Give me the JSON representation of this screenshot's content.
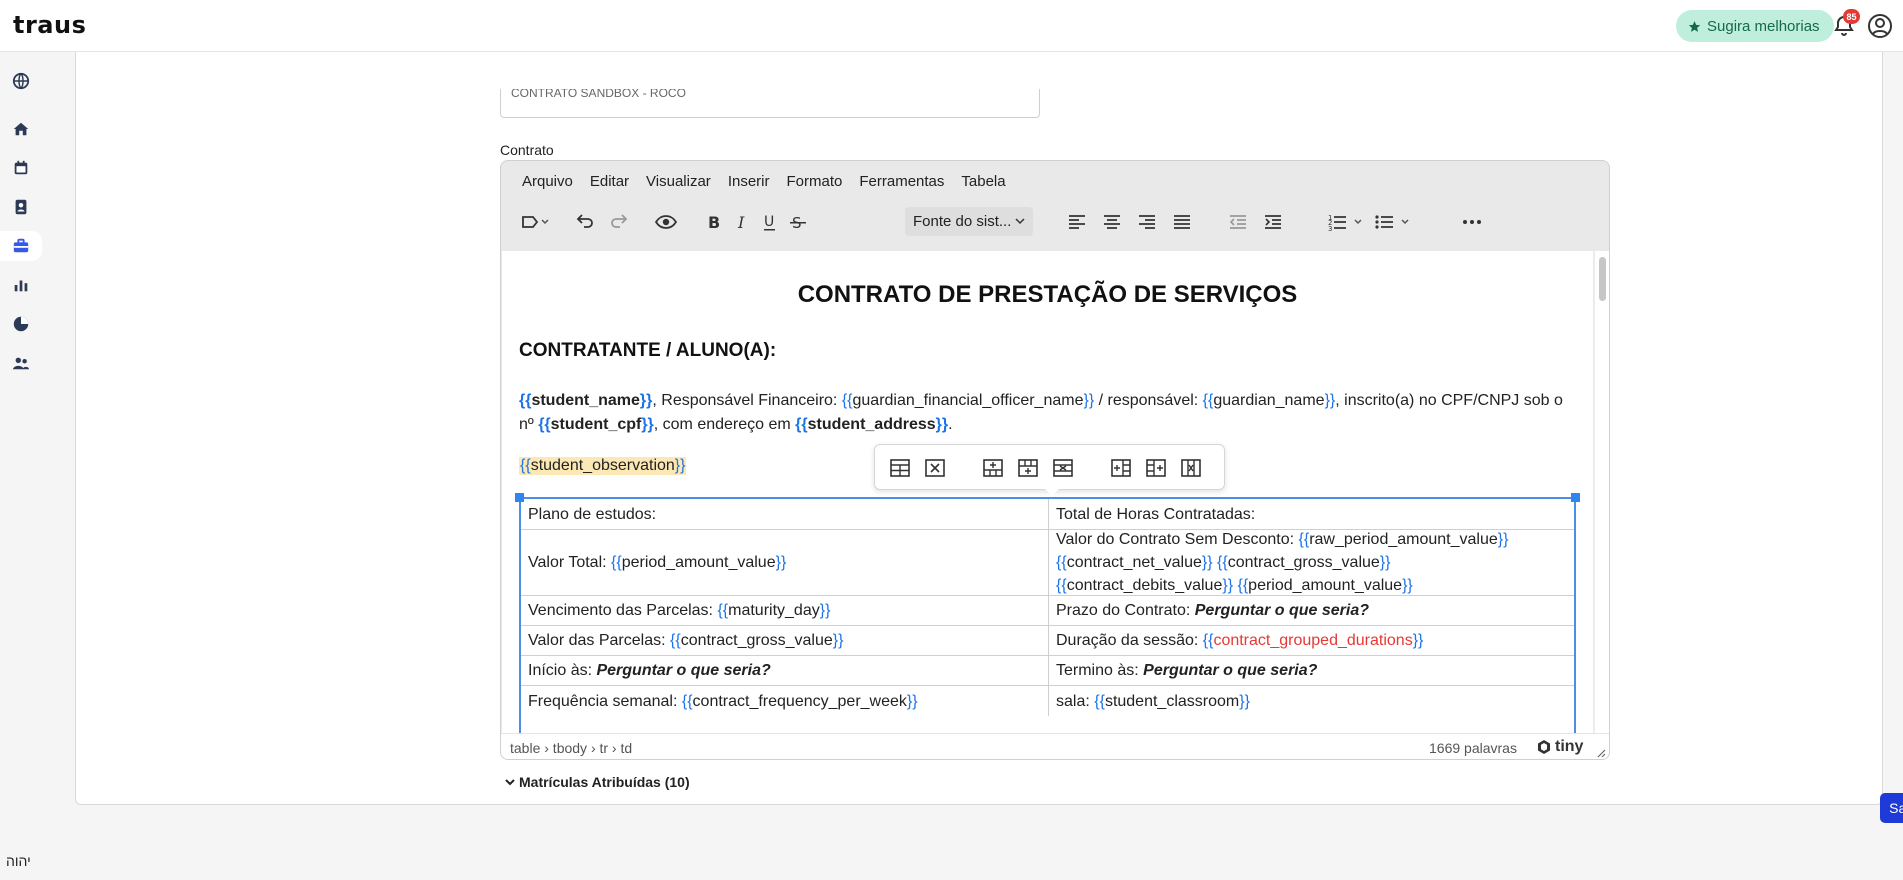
{
  "topbar": {
    "logo": "traus",
    "suggest_label": "Sugira melhorias",
    "notification_count": "85"
  },
  "sidebar": {
    "items": [
      "globe-icon",
      "home-icon",
      "calendar-icon",
      "contacts-icon",
      "briefcase-icon",
      "bar-chart-icon",
      "pie-chart-icon",
      "team-icon"
    ],
    "active_index": 4,
    "footer_text": "יהוה"
  },
  "form": {
    "name_value": "CONTRATO SANDBOX - ROCO",
    "contract_label": "Contrato",
    "enrollments_label": "Matrículas Atribuídas (10)",
    "save_label": "Salvar"
  },
  "editor": {
    "menu": [
      "Arquivo",
      "Editar",
      "Visualizar",
      "Inserir",
      "Formato",
      "Ferramentas",
      "Tabela"
    ],
    "font_select": "Fonte do sist...",
    "status_path": "table › tbody › tr › td",
    "word_count": "1669 palavras",
    "brand": "tiny"
  },
  "document": {
    "title": "CONTRATO DE PRESTAÇÃO DE SERVIÇOS",
    "party_title": "CONTRATANTE / ALUNO(A):",
    "party": {
      "student_name": "student_name",
      "t1": ", Responsável Financeiro: ",
      "guardian_financial": "guardian_financial_officer_name",
      "t2": " / responsável: ",
      "guardian_name": "guardian_name",
      "t3": ", inscrito(a) no CPF/CNPJ sob o nº ",
      "student_cpf": "student_cpf",
      "t4": ", com endereço em ",
      "student_address": "student_address",
      "t5": "."
    },
    "observation": "student_observation",
    "table": {
      "r1c1": "Plano de estudos:",
      "r1c2": "Total de Horas Contratadas:",
      "r2c1_label": "Valor Total: ",
      "r2c1_var": "period_amount_value",
      "r2c2_label": "Valor do Contrato Sem Desconto: ",
      "r2c2_v1": "raw_period_amount_value",
      "r2c2_v2": "contract_net_value",
      "r2c2_v3": "contract_gross_value",
      "r2c2_v4": "contract_debits_value",
      "r2c2_v5": "period_amount_value",
      "r3c1_label": "Vencimento das Parcelas: ",
      "r3c1_var": "maturity_day",
      "r3c2_label": "Prazo do Contrato: ",
      "r3c2_value": "Perguntar o que seria?",
      "r4c1_label": "Valor das Parcelas: ",
      "r4c1_var": "contract_gross_value",
      "r4c2_label": "Duração da sessão: ",
      "r4c2_var": "contract_grouped_durations",
      "r5c1_label": "Início às: ",
      "r5c1_value": "Perguntar o que seria?",
      "r5c2_label": "Termino às: ",
      "r5c2_value": "Perguntar o que seria?",
      "r6c1_partial": "Frequência semanal: ",
      "r6c1_var": "contract_frequency_per_week",
      "r6c2_partial": "sala: ",
      "r6c2_var": "student_classroom"
    }
  },
  "colors": {
    "accent": "#1e3ad8",
    "variable": "#1a73e8",
    "highlight": "#fbe8b5",
    "error": "#e53935",
    "suggest_bg": "#bfeedd"
  }
}
